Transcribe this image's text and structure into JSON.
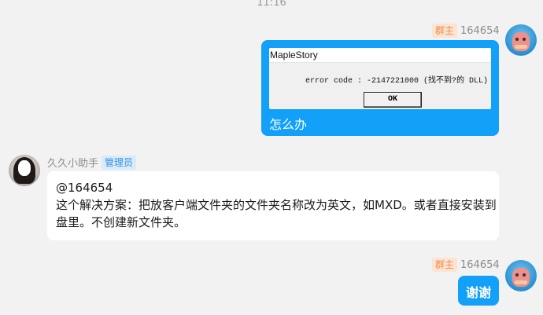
{
  "timestamp": "11:16",
  "messages": [
    {
      "sender_id": "164654",
      "role_badge": "群主",
      "image": {
        "window_title": "MapleStory",
        "error_text": "error code : -2147221000 (找不到?的 DLL)",
        "button_label": "OK"
      },
      "text": "怎么办"
    },
    {
      "sender_name": "久久小助手",
      "role_badge": "管理员",
      "mention": "@164654",
      "text": "这个解决方案：把放客户端文件夹的文件夹名称改为英文，如MXD。或者直接安装到盘里。不创建新文件夹。"
    },
    {
      "sender_id": "164654",
      "role_badge": "群主",
      "text": "谢谢"
    }
  ],
  "colors": {
    "self_bubble": "#12a0f8",
    "other_bubble": "#ffffff",
    "owner_badge": "#f08a4b",
    "admin_badge": "#3b8fd6"
  }
}
